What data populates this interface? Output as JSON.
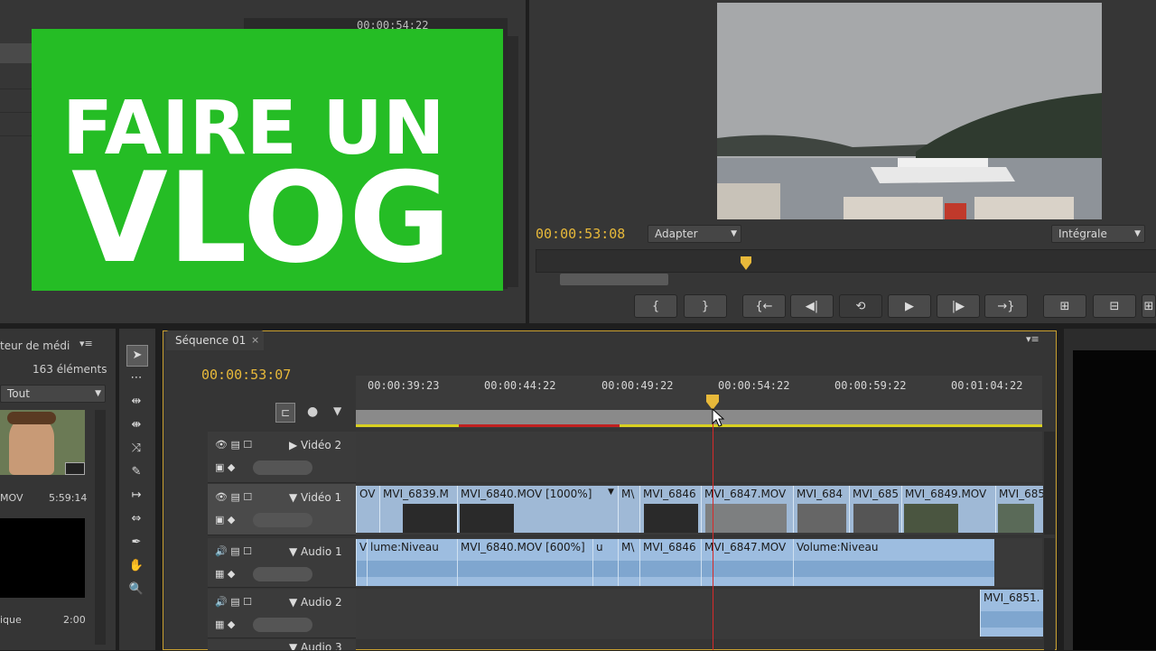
{
  "overlay": {
    "line1": "FAIRE UN",
    "line2": "VLOG"
  },
  "source_monitor": {
    "timecode_top": "00:00:54:22"
  },
  "program_monitor": {
    "timecode": "00:00:53:08",
    "zoom_label": "Adapter",
    "quality_label": "Intégrale",
    "buttons": [
      "{",
      "}",
      "{←",
      "◀|",
      "⟲",
      "▶",
      "|▶",
      "→}",
      "⊞",
      "⊟",
      "⊞"
    ]
  },
  "project_panel": {
    "title": "teur de médi",
    "count": "163 éléments",
    "filter": "Tout",
    "items": [
      {
        "name": "MOV",
        "duration": "5:59:14"
      },
      {
        "name": "ique",
        "duration": "2:00"
      }
    ]
  },
  "sequence": {
    "tab_label": "Séquence 01",
    "timecode": "00:00:53:07",
    "ruler": [
      "00:00:39:23",
      "00:00:44:22",
      "00:00:49:22",
      "00:00:54:22",
      "00:00:59:22",
      "00:01:04:22"
    ],
    "tracks": {
      "video2": "Vidéo 2",
      "video1": "Vidéo 1",
      "audio1": "Audio 1",
      "audio2": "Audio 2",
      "audio3": "Audio 3"
    },
    "video_clips": [
      "OV",
      "MVI_6839.M",
      "MVI_6840.MOV [1000%]",
      "M\\",
      "MVI_6846",
      "MVI_6847.MOV",
      "MVI_684",
      "MVI_685",
      "MVI_6849.MOV",
      "MVI_685"
    ],
    "audio_clips": [
      "V",
      "lume:Niveau",
      "MVI_6840.MOV [600%]",
      "u",
      "M\\",
      "MVI_6846",
      "MVI_6847.MOV",
      "Volume:Niveau"
    ],
    "audio2_clip": "MVI_6851."
  },
  "colors": {
    "accent_green": "#25bd25",
    "timecode": "#e8b93a",
    "clip_video": "#9fb9d6",
    "clip_audio": "#9dbde0",
    "playhead": "#d62a2a"
  }
}
